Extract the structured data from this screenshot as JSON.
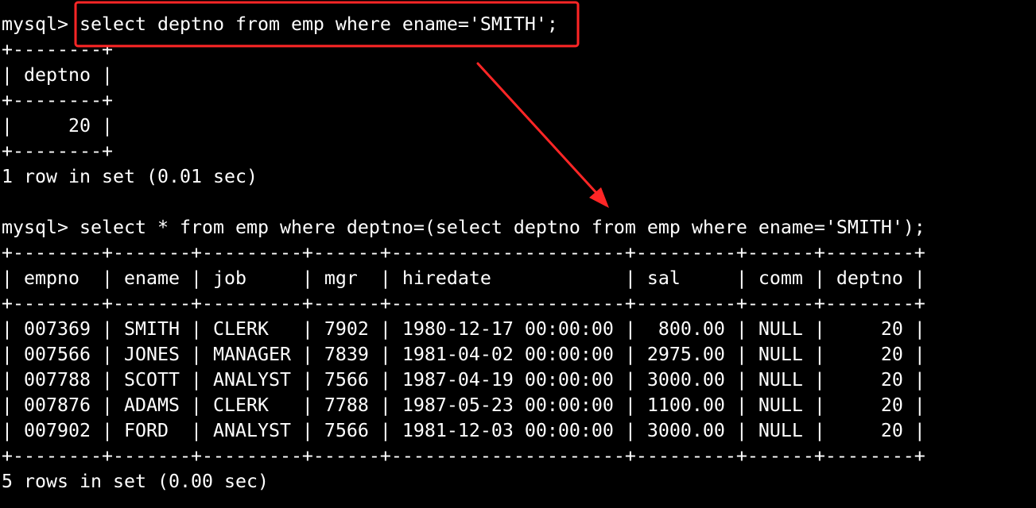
{
  "terminal": {
    "prompt": "mysql> ",
    "query1": "select deptno from emp where ename='SMITH';",
    "result1": {
      "border": "+--------+",
      "header": "| deptno |",
      "rows": [
        "|     20 |"
      ],
      "status": "1 row in set (0.01 sec)"
    },
    "query2": "select * from emp where deptno=(select deptno from emp where ename='SMITH');",
    "result2": {
      "border": "+--------+-------+---------+------+---------------------+---------+------+--------+",
      "header": "| empno  | ename | job     | mgr  | hiredate            | sal     | comm | deptno |",
      "rows": [
        "| 007369 | SMITH | CLERK   | 7902 | 1980-12-17 00:00:00 |  800.00 | NULL |     20 |",
        "| 007566 | JONES | MANAGER | 7839 | 1981-04-02 00:00:00 | 2975.00 | NULL |     20 |",
        "| 007788 | SCOTT | ANALYST | 7566 | 1987-04-19 00:00:00 | 3000.00 | NULL |     20 |",
        "| 007876 | ADAMS | CLERK   | 7788 | 1987-05-23 00:00:00 | 1100.00 | NULL |     20 |",
        "| 007902 | FORD  | ANALYST | 7566 | 1981-12-03 00:00:00 | 3000.00 | NULL |     20 |"
      ],
      "status": "5 rows in set (0.00 sec)"
    }
  },
  "annotation": {
    "color": "#ff2626"
  }
}
